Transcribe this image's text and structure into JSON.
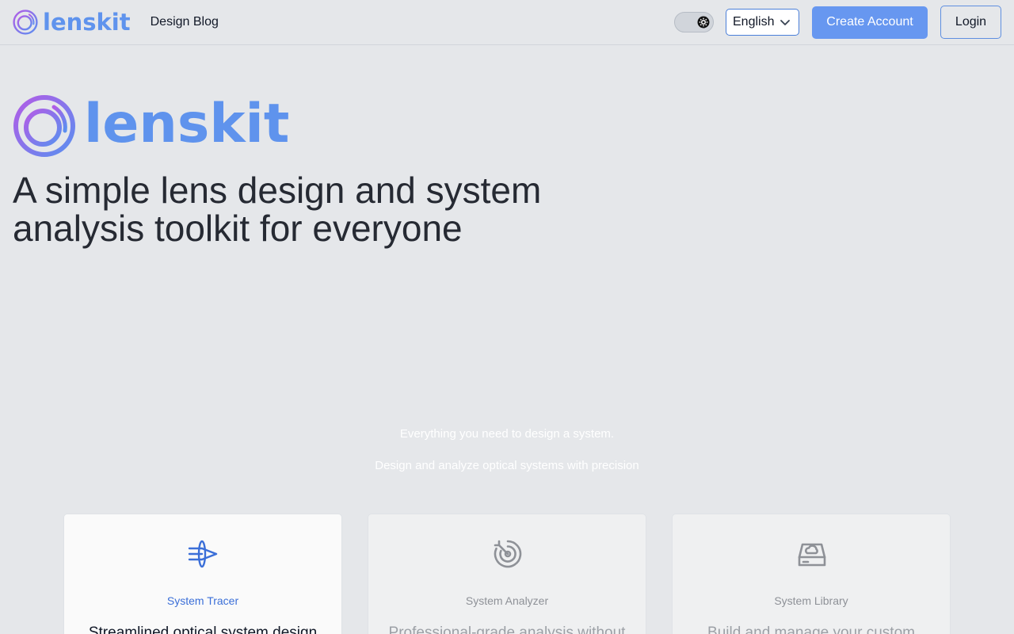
{
  "header": {
    "brand": "lenskit",
    "nav_link": "Design Blog",
    "theme_toggle": "theme-toggle",
    "language": "English",
    "create_account": "Create Account",
    "login": "Login"
  },
  "hero": {
    "brand": "lenskit",
    "headline_line1": "A simple lens design and system",
    "headline_line2": "analysis toolkit for everyone"
  },
  "features_intro": {
    "line1": "Everything you need to design a system.",
    "line2": "Design and analyze optical systems with precision"
  },
  "cards": [
    {
      "title": "System Tracer",
      "desc": "Streamlined optical system design",
      "icon": "ray-trace-icon",
      "active": true
    },
    {
      "title": "System Analyzer",
      "desc": "Professional-grade analysis without",
      "icon": "radar-icon",
      "active": false
    },
    {
      "title": "System Library",
      "desc": "Build and manage your custom",
      "icon": "cloud-drive-icon",
      "active": false
    }
  ],
  "colors": {
    "brand_blue": "#5f93ed",
    "brand_purple": "#a25ee8",
    "active_blue": "#3b6fd8",
    "page_bg": "#e5e7ea"
  }
}
